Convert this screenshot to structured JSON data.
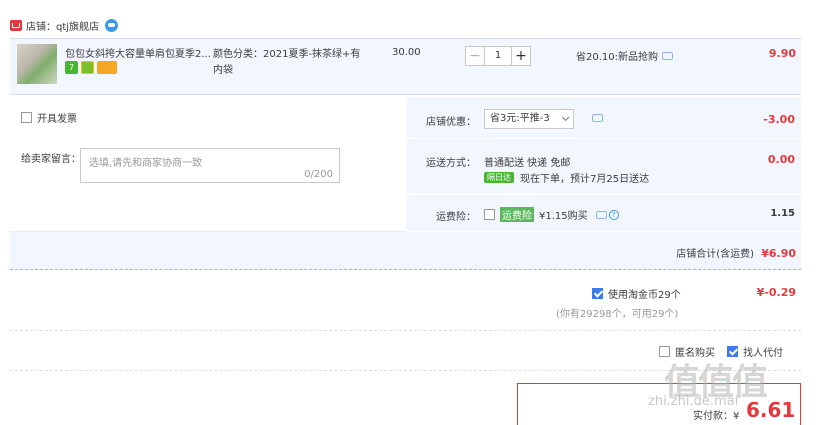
{
  "shop": {
    "label": "店铺：qtj旗舰店"
  },
  "item": {
    "title": "包包女斜挎大容量单肩包夏季2...",
    "badges": [
      "7",
      "",
      ""
    ],
    "sku_lines": [
      "颜色分类：2021夏季-抹茶绿+有",
      "内袋"
    ],
    "unit_price": "30.00",
    "quantity": "1",
    "qty_minus": "−",
    "qty_plus": "+",
    "discount_note": "省20.10:新品抢购",
    "total": "9.90"
  },
  "invoice": {
    "label": "开具发票"
  },
  "memo": {
    "label": "给卖家留言：",
    "placeholder": "选填,请先和商家协商一致",
    "count": "0/200"
  },
  "coupon": {
    "label": "店铺优惠：",
    "selected": "省3元:平推-3",
    "amount": "-3.00"
  },
  "shipping": {
    "label": "运送方式：",
    "method": "普通配送 快递 免邮",
    "badge": "隔日达",
    "eta": "现在下单，预计7月25日送达",
    "amount": "0.00"
  },
  "insurance": {
    "label": "运费险：",
    "tag": "运费险",
    "desc": "¥1.15购买",
    "help": "?",
    "amount": "1.15"
  },
  "shop_total": {
    "label": "店铺合计(含运费)",
    "amount": "¥6.90"
  },
  "coins": {
    "label": "使用淘金币29个",
    "sub": "(你有29298个，可用29个)",
    "amount": "¥-0.29"
  },
  "extra": {
    "anonymous": "匿名购买",
    "gift": "找人代付"
  },
  "pay": {
    "label": "实付款：¥",
    "amount": "6.61"
  },
  "watermark": {
    "main": "值值值",
    "sub": "zhi.zhi.de.mai"
  },
  "colors": {
    "accent_red": "#e4393c",
    "row_bg": "#f2f7ff",
    "link_blue": "#3a9ae8"
  }
}
